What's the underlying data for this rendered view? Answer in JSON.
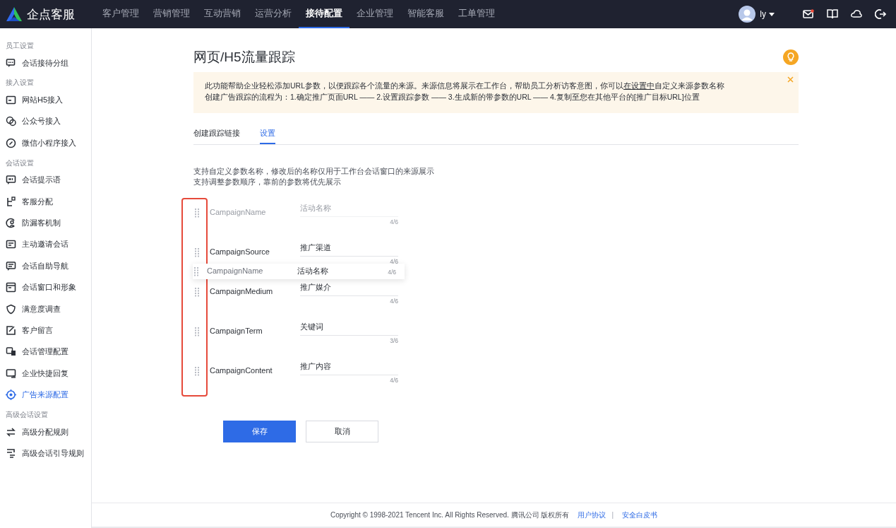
{
  "topbar": {
    "brand": "企点客服",
    "nav": [
      {
        "label": "客户管理",
        "selected": false
      },
      {
        "label": "营销管理",
        "selected": false
      },
      {
        "label": "互动营销",
        "selected": false
      },
      {
        "label": "运营分析",
        "selected": false
      },
      {
        "label": "接待配置",
        "selected": true
      },
      {
        "label": "企业管理",
        "selected": false
      },
      {
        "label": "智能客服",
        "selected": false
      },
      {
        "label": "工单管理",
        "selected": false
      }
    ],
    "user": "ly",
    "mail_unread": true
  },
  "sidebar": {
    "groups": [
      {
        "heading": "员工设置",
        "items": [
          {
            "label": "会话接待分组",
            "selected": false
          }
        ]
      },
      {
        "heading": "接入设置",
        "items": [
          {
            "label": "网站H5接入",
            "selected": false
          },
          {
            "label": "公众号接入",
            "selected": false
          },
          {
            "label": "微信小程序接入",
            "selected": false
          }
        ]
      },
      {
        "heading": "会话设置",
        "items": [
          {
            "label": "会话提示语",
            "selected": false
          },
          {
            "label": "客服分配",
            "selected": false
          },
          {
            "label": "防漏客机制",
            "selected": false
          },
          {
            "label": "主动邀请会话",
            "selected": false
          },
          {
            "label": "会话自助导航",
            "selected": false
          },
          {
            "label": "会话窗口和形象",
            "selected": false
          },
          {
            "label": "满意度调查",
            "selected": false
          },
          {
            "label": "客户留言",
            "selected": false
          },
          {
            "label": "会话管理配置",
            "selected": false
          },
          {
            "label": "企业快捷回复",
            "selected": false
          },
          {
            "label": "广告来源配置",
            "selected": true
          }
        ]
      },
      {
        "heading": "高级会话设置",
        "items": [
          {
            "label": "高级分配规则",
            "selected": false
          },
          {
            "label": "高级会话引导规则",
            "selected": false
          }
        ]
      }
    ]
  },
  "page": {
    "title": "网页/H5流量跟踪",
    "notice": {
      "line_1": {
        "before": "此功能帮助企业轻松添加URL参数，以便跟踪各个流量的来源。来源信息将展示在工作台，帮助员工分析访客意图，你可以",
        "link": "在设置中",
        "after": "自定义来源参数名称"
      },
      "line_2": "创建广告跟踪的流程为：1.确定推广页面URL —— 2.设置跟踪参数 —— 3.生成新的带参数的URL —— 4.复制至您在其他平台的[推广目标URL]位置"
    },
    "tabs": [
      {
        "label": "创建跟踪链接",
        "selected": false
      },
      {
        "label": "设置",
        "selected": true
      }
    ],
    "hints": [
      "支持自定义参数名称，修改后的名称仅用于工作台会话窗口的来源展示",
      "支持调整参数顺序，靠前的参数将优先展示"
    ],
    "handles_highlighted": true,
    "params": [
      {
        "kind": "placeholder",
        "name": "CampaignName",
        "value": "活动名称",
        "counter": "4/6"
      },
      {
        "kind": "normal",
        "name": "CampaignSource",
        "value": "推广渠道",
        "counter": "4/6"
      },
      {
        "kind": "normal",
        "name": "CampaignMedium",
        "value": "推广媒介",
        "counter": "4/6"
      },
      {
        "kind": "normal",
        "name": "CampaignTerm",
        "value": "关键词",
        "counter": "3/6"
      },
      {
        "kind": "normal",
        "name": "CampaignContent",
        "value": "推广内容",
        "counter": "4/6"
      }
    ],
    "dragging": {
      "name": "CampaignName",
      "value": "活动名称",
      "counter": "4/6"
    },
    "buttons": [
      {
        "kind": "primary",
        "label": "保存"
      },
      {
        "kind": "default",
        "label": "取消"
      }
    ]
  },
  "footer": {
    "copyright": "Copyright © 1998-2021 Tencent Inc. All Rights Reserved. 腾讯公司 版权所有",
    "links": [
      "用户协议",
      "安全白皮书"
    ],
    "separator": "|"
  }
}
